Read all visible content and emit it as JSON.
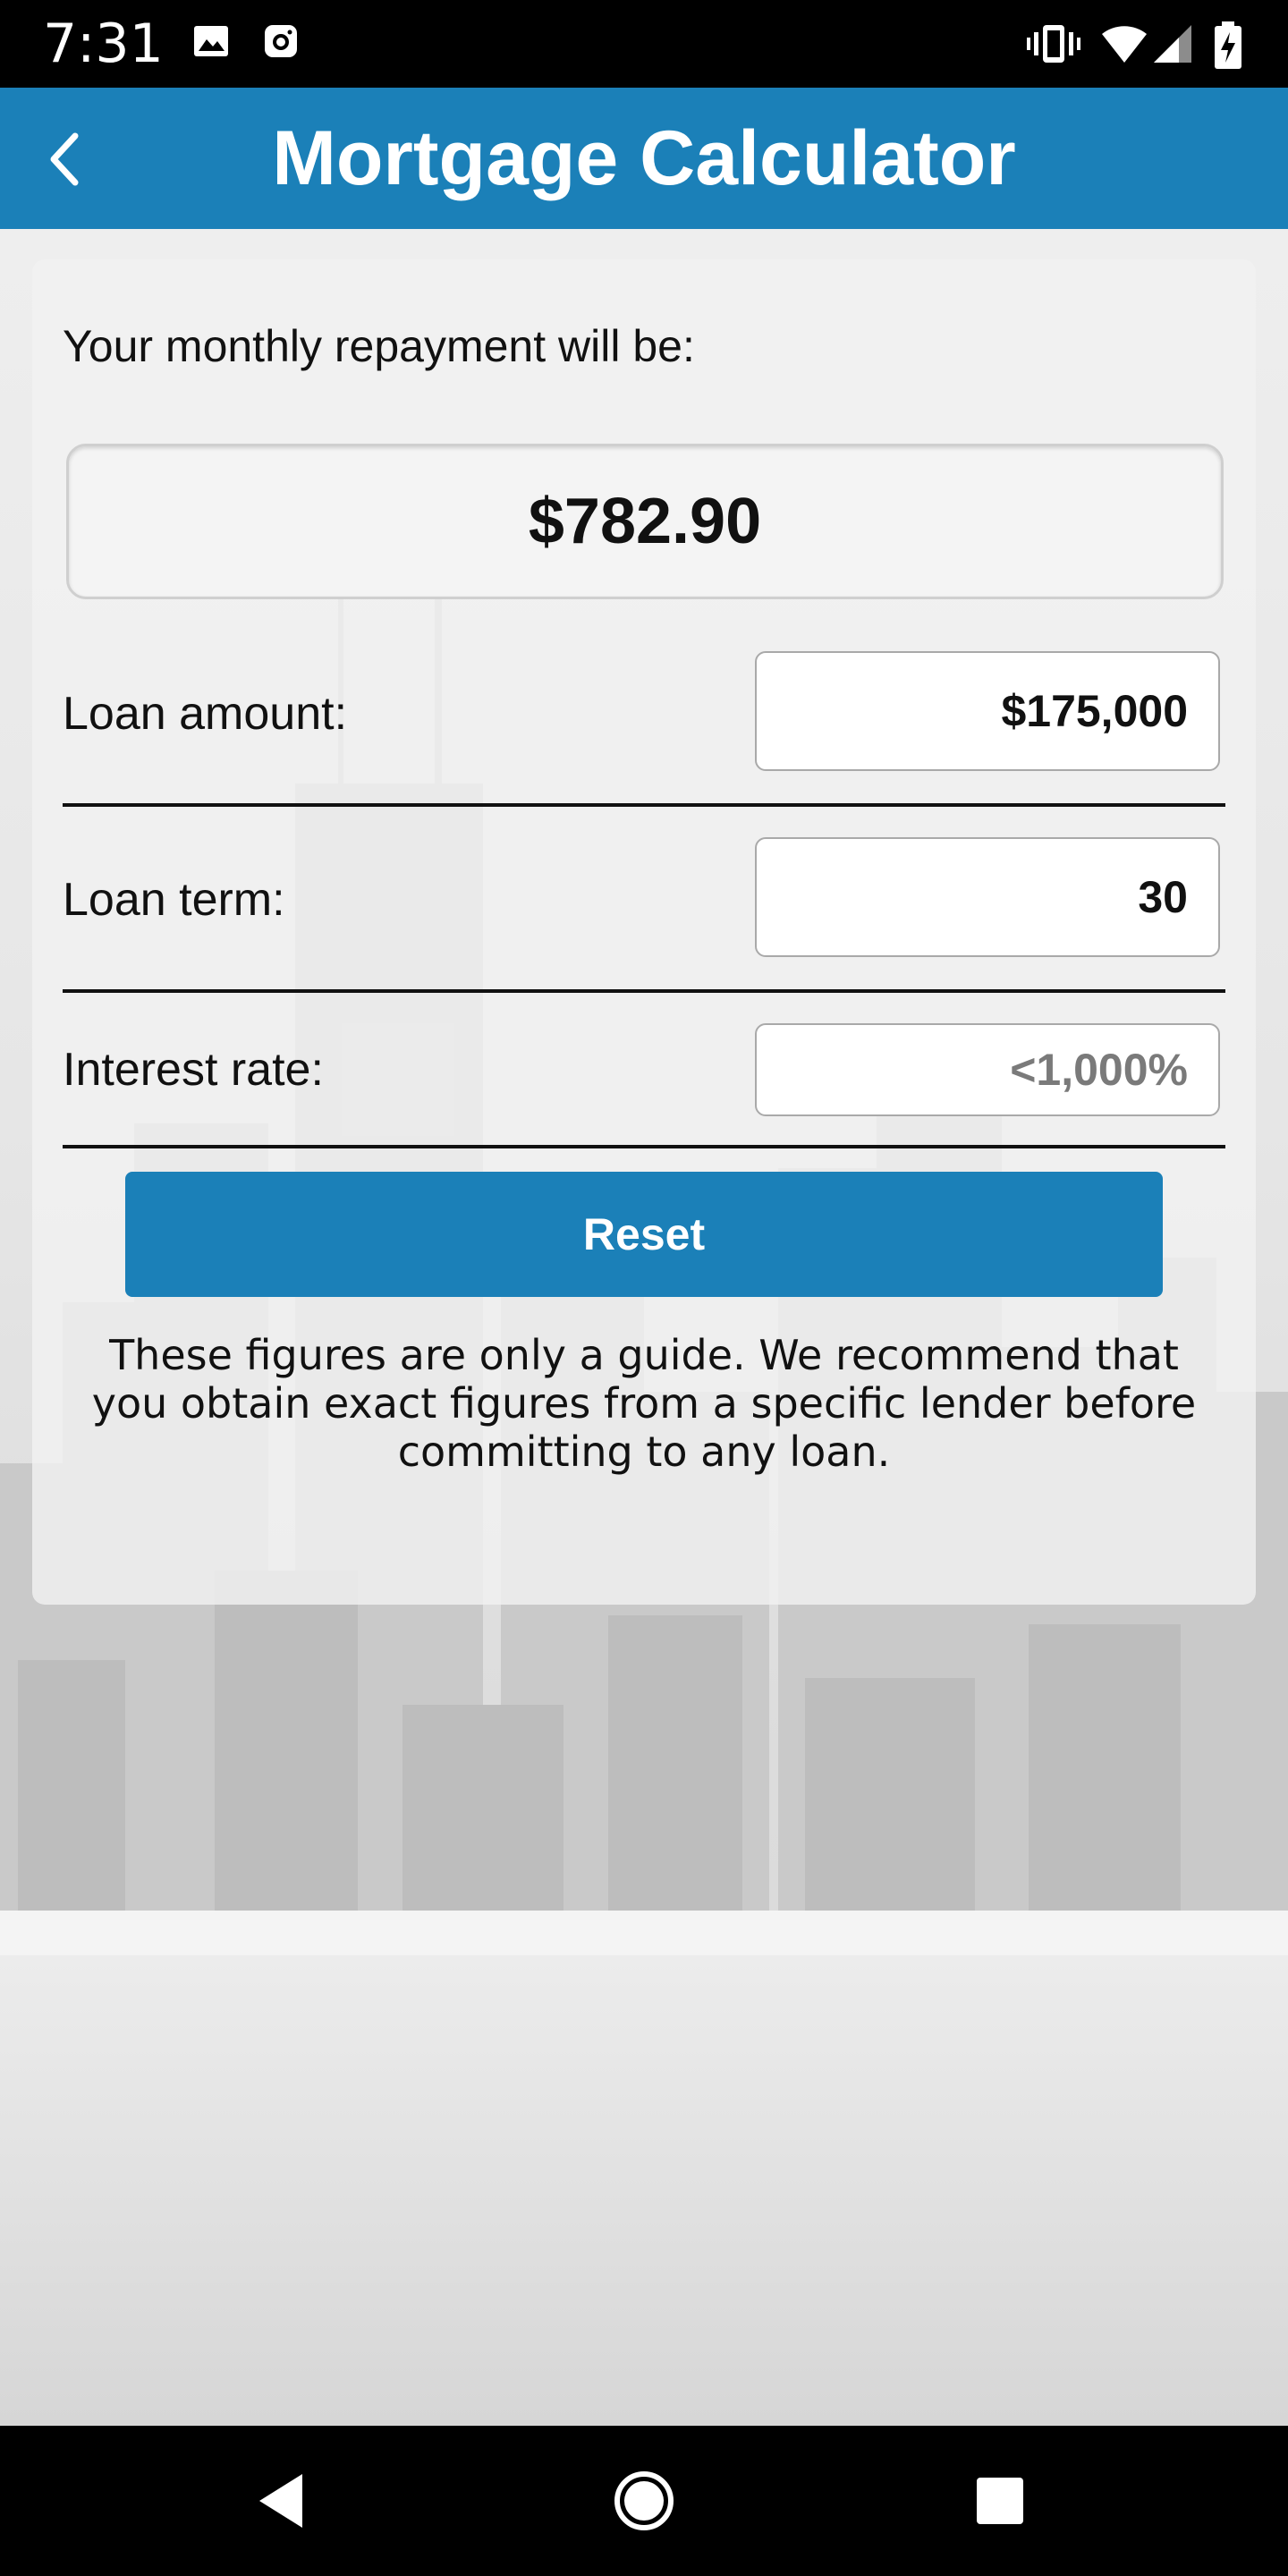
{
  "status_bar": {
    "time": "7:31",
    "left_icons": [
      "image-icon",
      "instagram-icon"
    ],
    "right_icons": [
      "vibrate-icon",
      "wifi-icon",
      "signal-icon",
      "battery-charging-icon"
    ]
  },
  "app_bar": {
    "title": "Mortgage Calculator",
    "back_icon": "chevron-left-icon"
  },
  "calculator": {
    "lead_text": "Your monthly repayment will be:",
    "monthly_repayment": "$782.90",
    "loan_amount": {
      "label": "Loan amount:",
      "value": "$175,000"
    },
    "loan_term": {
      "label": "Loan term:",
      "value": "30"
    },
    "interest_rate": {
      "label": "Interest rate:",
      "value": "",
      "placeholder": "<1,000%"
    },
    "reset_label": "Reset",
    "disclaimer": "These figures are only a guide. We recommend that you obtain exact figures from a specific lender before committing to any loan."
  },
  "nav_bar": {
    "buttons": [
      "back-triangle-icon",
      "home-circle-icon",
      "recents-square-icon"
    ]
  },
  "colors": {
    "accent": "#1b80b8",
    "status_bar": "#000000",
    "nav_bar": "#000000"
  }
}
